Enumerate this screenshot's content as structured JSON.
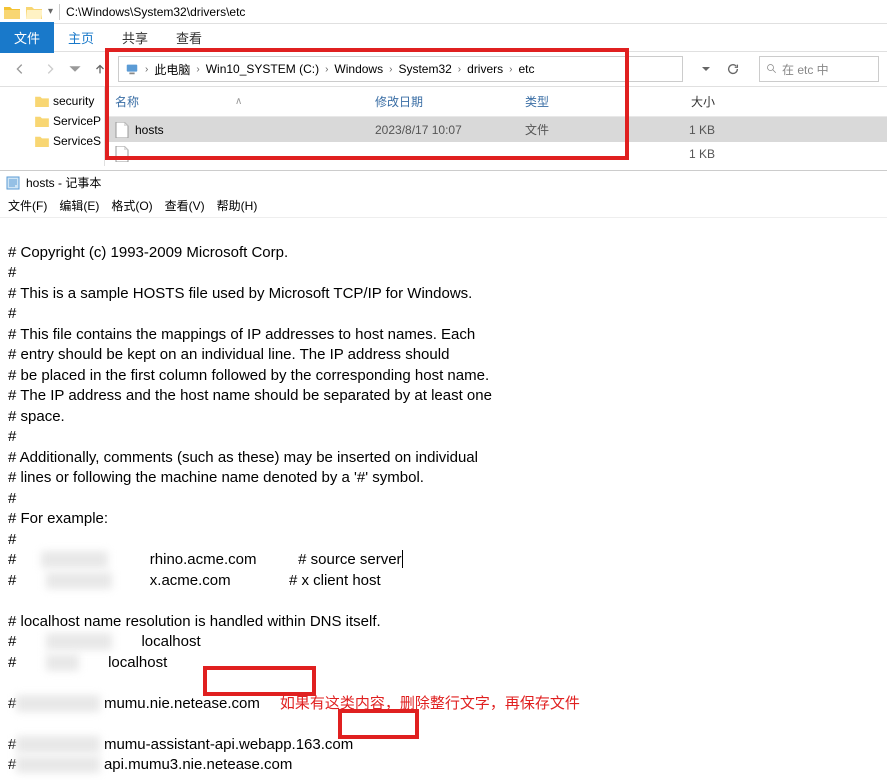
{
  "explorer": {
    "title_path": "C:\\Windows\\System32\\drivers\\etc",
    "tabs": {
      "file": "文件",
      "home": "主页",
      "share": "共享",
      "view": "查看"
    },
    "nav": {
      "crumbs": [
        "此电脑",
        "Win10_SYSTEM (C:)",
        "Windows",
        "System32",
        "drivers",
        "etc"
      ],
      "search_placeholder": "在 etc 中"
    },
    "tree": [
      {
        "label": "security"
      },
      {
        "label": "ServiceP"
      },
      {
        "label": "ServiceS"
      }
    ],
    "columns": {
      "name": "名称",
      "date": "修改日期",
      "type": "类型",
      "size": "大小"
    },
    "rows": [
      {
        "name": "hosts",
        "date": "2023/8/17 10:07",
        "type": "文件",
        "size": "1 KB",
        "selected": true
      },
      {
        "name": "",
        "date": "",
        "type": "",
        "size": "1 KB",
        "selected": false
      }
    ]
  },
  "notepad": {
    "title": "hosts - 记事本",
    "menu": {
      "file": "文件(F)",
      "edit": "编辑(E)",
      "format": "格式(O)",
      "view": "查看(V)",
      "help": "帮助(H)"
    },
    "lines": {
      "l1": "# Copyright (c) 1993-2009 Microsoft Corp.",
      "l2": "#",
      "l3": "# This is a sample HOSTS file used by Microsoft TCP/IP for Windows.",
      "l4": "#",
      "l5": "# This file contains the mappings of IP addresses to host names. Each",
      "l6": "# entry should be kept on an individual line. The IP address should",
      "l7": "# be placed in the first column followed by the corresponding host name.",
      "l8": "# The IP address and the host name should be separated by at least one",
      "l9": "# space.",
      "l10": "#",
      "l11": "# Additionally, comments (such as these) may be inserted on individual",
      "l12": "# lines or following the machine name denoted by a '#' symbol.",
      "l13": "#",
      "l14": "# For example:",
      "l15": "#",
      "l16a": "#      ",
      "l16b": "          rhino.acme.com          # source server",
      "l17a": "#       ",
      "l17b": "         x.acme.com              # x client host",
      "l18": "",
      "l19": "# localhost name resolution is handled within DNS itself.",
      "l20a": "#       ",
      "l20b": "       localhost",
      "l21a": "#       ",
      "l21b": "       localhost",
      "l22": "",
      "l23a": "#",
      "l23b": " mumu.nie.",
      "l23c": "netease.com",
      "l24": "",
      "l25a": "#",
      "l25b": " mumu-assistant-api.webapp.",
      "l25c": "163.com",
      "l26a": "#",
      "l26b": " api.mumu3.nie.netease.com"
    },
    "annotation": "如果有这类内容，删除整行文字，再保存文件"
  }
}
